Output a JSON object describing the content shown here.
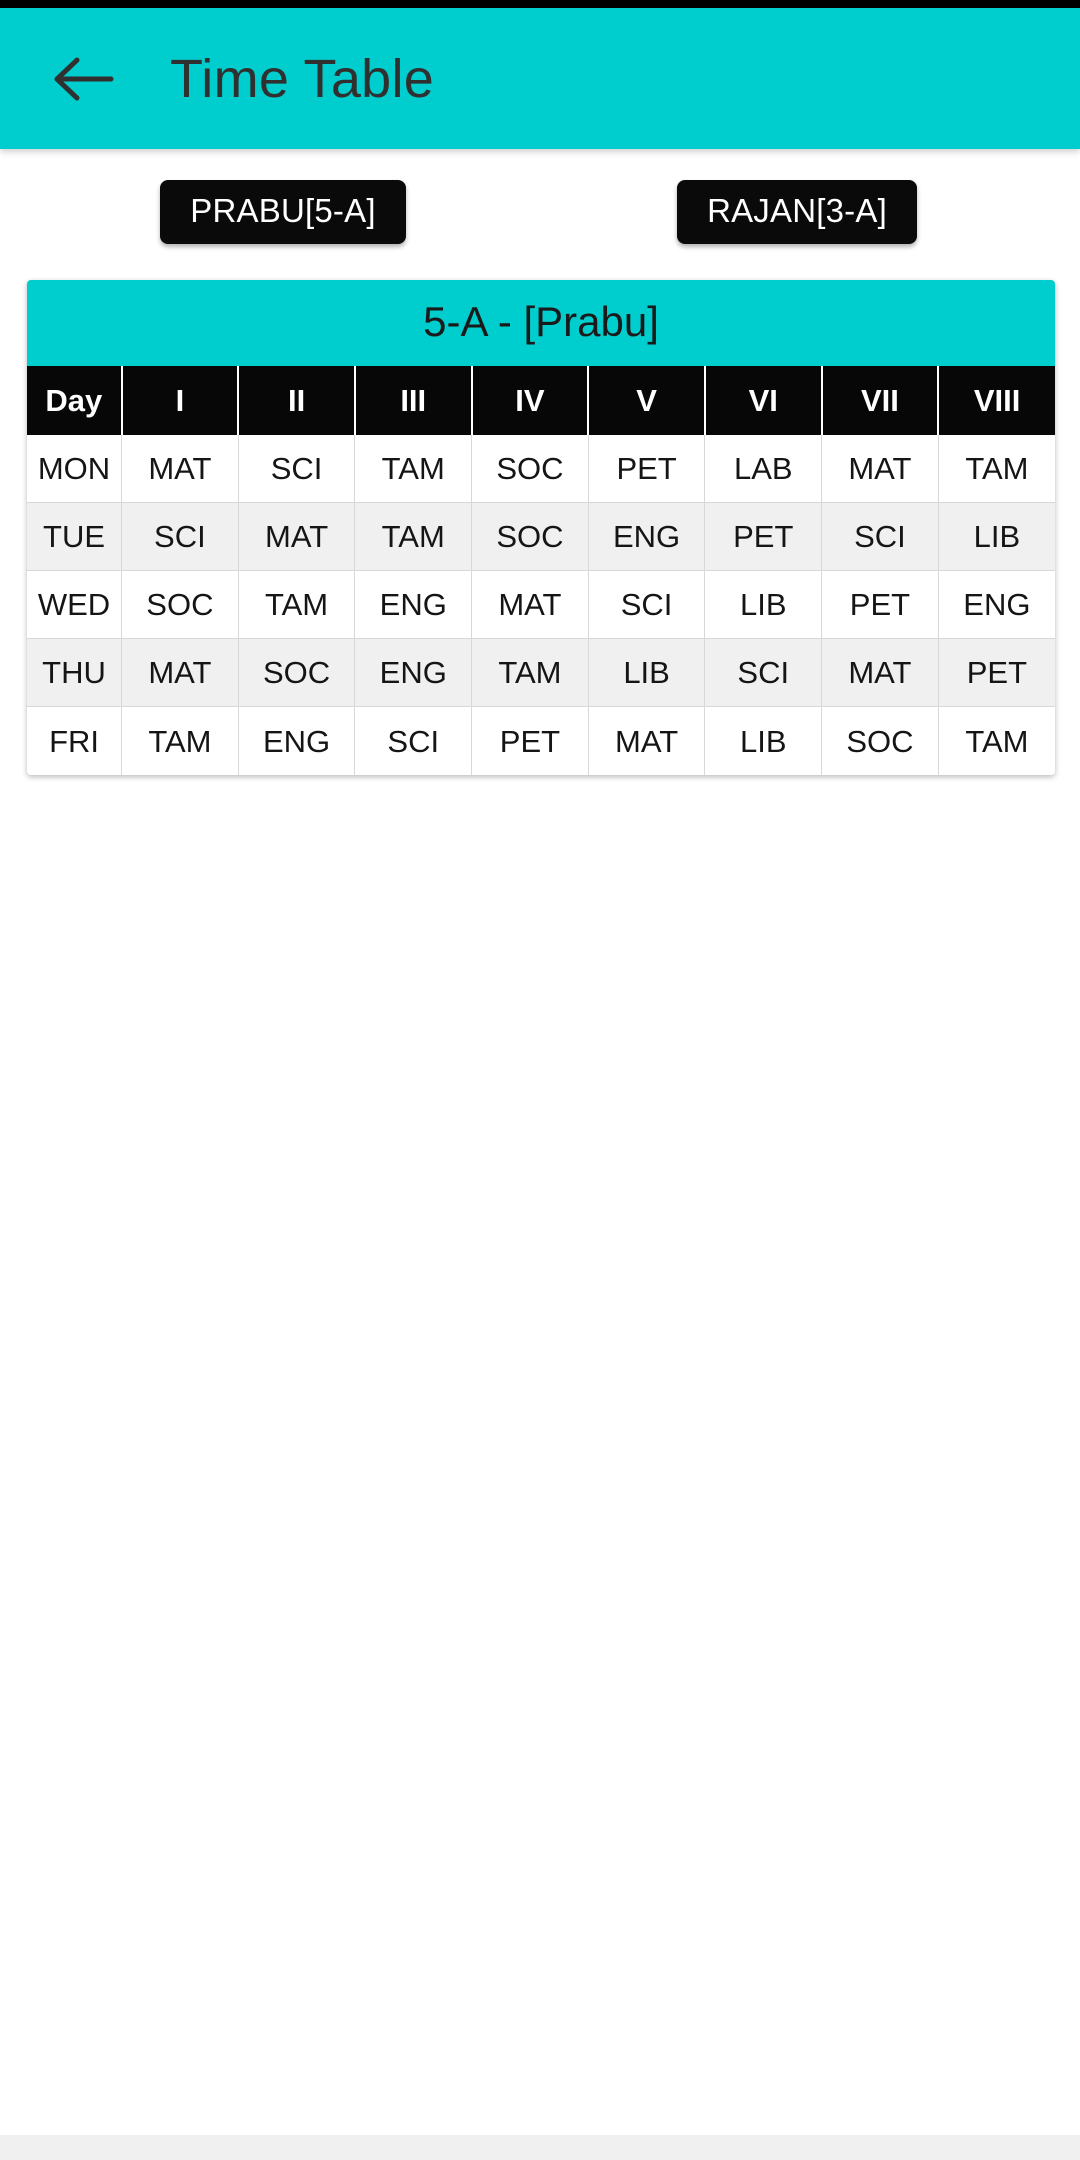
{
  "app_bar": {
    "back_icon": "arrow-left-icon",
    "title": "Time Table",
    "background": "#00CDCD",
    "title_color": "#303030"
  },
  "teacher_chips": [
    {
      "label": "PRABU[5-A]"
    },
    {
      "label": "RAJAN[3-A]"
    }
  ],
  "timetable": {
    "title": "5-A - [Prabu]",
    "title_background": "#00CDCD",
    "header_background": "#070707",
    "columns": [
      "Day",
      "I",
      "II",
      "III",
      "IV",
      "V",
      "VI",
      "VII",
      "VIII"
    ],
    "rows": [
      {
        "day": "MON",
        "periods": [
          "MAT",
          "SCI",
          "TAM",
          "SOC",
          "PET",
          "LAB",
          "MAT",
          "TAM"
        ]
      },
      {
        "day": "TUE",
        "periods": [
          "SCI",
          "MAT",
          "TAM",
          "SOC",
          "ENG",
          "PET",
          "SCI",
          "LIB"
        ]
      },
      {
        "day": "WED",
        "periods": [
          "SOC",
          "TAM",
          "ENG",
          "MAT",
          "SCI",
          "LIB",
          "PET",
          "ENG"
        ]
      },
      {
        "day": "THU",
        "periods": [
          "MAT",
          "SOC",
          "ENG",
          "TAM",
          "LIB",
          "SCI",
          "MAT",
          "PET"
        ]
      },
      {
        "day": "FRI",
        "periods": [
          "TAM",
          "ENG",
          "SCI",
          "PET",
          "MAT",
          "LIB",
          "SOC",
          "TAM"
        ]
      }
    ]
  }
}
